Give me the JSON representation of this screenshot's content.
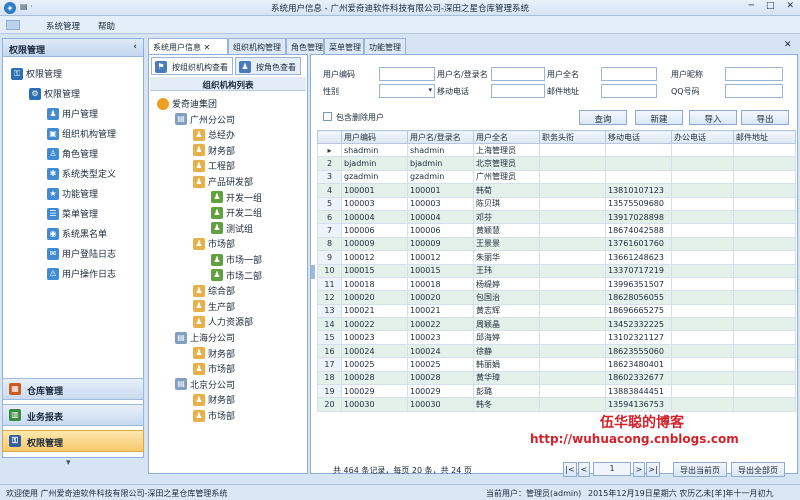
{
  "window": {
    "title": "系统用户信息 - 广州爱奇迪软件科技有限公司-深田之星仓库管理系统",
    "qat": "▤ ·"
  },
  "menu": {
    "items": [
      "系统管理",
      "帮助"
    ]
  },
  "left": {
    "header": "权限管理",
    "tree": [
      {
        "label": "权限管理",
        "level": 0
      },
      {
        "label": "权限管理",
        "level": 1
      },
      {
        "label": "用户管理",
        "level": 2
      },
      {
        "label": "组织机构管理",
        "level": 2
      },
      {
        "label": "角色管理",
        "level": 2
      },
      {
        "label": "系统类型定义",
        "level": 2
      },
      {
        "label": "功能管理",
        "level": 2
      },
      {
        "label": "菜单管理",
        "level": 2
      },
      {
        "label": "系统黑名单",
        "level": 2
      },
      {
        "label": "用户登陆日志",
        "level": 2
      },
      {
        "label": "用户操作日志",
        "level": 2
      }
    ],
    "nav": [
      "仓库管理",
      "业务报表",
      "权限管理"
    ]
  },
  "tabs": [
    "系统用户信息",
    "组织机构管理",
    "角色管理",
    "菜单管理",
    "功能管理"
  ],
  "org": {
    "subtabs": [
      "按组织机构查看",
      "按角色查看"
    ],
    "heading": "组织机构列表",
    "tree": [
      {
        "label": "爱奇迪集团",
        "level": 0
      },
      {
        "label": "广州分公司",
        "level": 1
      },
      {
        "label": "总经办",
        "level": 2
      },
      {
        "label": "财务部",
        "level": 2
      },
      {
        "label": "工程部",
        "level": 2
      },
      {
        "label": "产品研发部",
        "level": 2
      },
      {
        "label": "开发一组",
        "level": 3
      },
      {
        "label": "开发二组",
        "level": 3
      },
      {
        "label": "测试组",
        "level": 3
      },
      {
        "label": "市场部",
        "level": 2
      },
      {
        "label": "市场一部",
        "level": 3
      },
      {
        "label": "市场二部",
        "level": 3
      },
      {
        "label": "综合部",
        "level": 2
      },
      {
        "label": "生产部",
        "level": 2
      },
      {
        "label": "人力资源部",
        "level": 2
      },
      {
        "label": "上海分公司",
        "level": 1
      },
      {
        "label": "财务部",
        "level": 2
      },
      {
        "label": "市场部",
        "level": 2
      },
      {
        "label": "北京分公司",
        "level": 1
      },
      {
        "label": "财务部",
        "level": 2
      },
      {
        "label": "市场部",
        "level": 2
      }
    ]
  },
  "filter": {
    "labels": [
      "用户编码",
      "用户名/登录名",
      "用户全名",
      "用户昵称",
      "性别",
      "移动电话",
      "邮件地址",
      "QQ号码"
    ],
    "include_deleted": "包含删除用户",
    "buttons": [
      "查询",
      "新建",
      "导入",
      "导出"
    ]
  },
  "grid": {
    "columns": [
      "用户编码",
      "用户名/登录名",
      "用户全名",
      "职务头衔",
      "移动电话",
      "办公电话",
      "邮件地址"
    ],
    "rows": [
      [
        "shadmin",
        "shadmin",
        "上海管理员",
        "",
        "",
        "",
        ""
      ],
      [
        "bjadmin",
        "bjadmin",
        "北京管理员",
        "",
        "",
        "",
        ""
      ],
      [
        "gzadmin",
        "gzadmin",
        "广州管理员",
        "",
        "",
        "",
        ""
      ],
      [
        "100001",
        "100001",
        "韩荀",
        "",
        "13810107123",
        "",
        ""
      ],
      [
        "100003",
        "100003",
        "陈贝琪",
        "",
        "13575509680",
        "",
        ""
      ],
      [
        "100004",
        "100004",
        "邓芬",
        "",
        "13917028898",
        "",
        ""
      ],
      [
        "100006",
        "100006",
        "黄颖慧",
        "",
        "18674042588",
        "",
        ""
      ],
      [
        "100009",
        "100009",
        "王景景",
        "",
        "13761601760",
        "",
        ""
      ],
      [
        "100012",
        "100012",
        "朱丽华",
        "",
        "13661248623",
        "",
        ""
      ],
      [
        "100015",
        "100015",
        "王玮",
        "",
        "13370717219",
        "",
        ""
      ],
      [
        "100018",
        "100018",
        "杨缇婷",
        "",
        "13996351507",
        "",
        ""
      ],
      [
        "100020",
        "100020",
        "包国治",
        "",
        "18628056055",
        "",
        ""
      ],
      [
        "100021",
        "100021",
        "黄志辉",
        "",
        "18696665275",
        "",
        ""
      ],
      [
        "100022",
        "100022",
        "周颖晶",
        "",
        "13452332225",
        "",
        ""
      ],
      [
        "100023",
        "100023",
        "邱海婷",
        "",
        "13102321127",
        "",
        ""
      ],
      [
        "100024",
        "100024",
        "徐静",
        "",
        "18623555060",
        "",
        ""
      ],
      [
        "100025",
        "100025",
        "韩丽娟",
        "",
        "18623480401",
        "",
        ""
      ],
      [
        "100028",
        "100028",
        "黄华璋",
        "",
        "18602332677",
        "",
        ""
      ],
      [
        "100029",
        "100029",
        "彭璐",
        "",
        "13883844451",
        "",
        ""
      ],
      [
        "100030",
        "100030",
        "韩冬",
        "",
        "13594136753",
        "",
        ""
      ]
    ]
  },
  "pager": {
    "summary": "共 464 条记录，每页 20 条，共 24 页",
    "page": "1",
    "first": "|<",
    "prev": "<",
    "next": ">",
    "last": ">|",
    "export_page": "导出当前页",
    "export_all": "导出全部页"
  },
  "watermark": {
    "line1": "伍华聪的博客",
    "line2": "http://wuhuacong.cnblogs.com"
  },
  "status": {
    "left": "欢迎使用 广州爱奇迪软件科技有限公司-深田之星仓库管理系统",
    "user": "当前用户：管理员(admin)",
    "date": "2015年12月19日星期六 农历乙未[羊]年十一月初九"
  }
}
